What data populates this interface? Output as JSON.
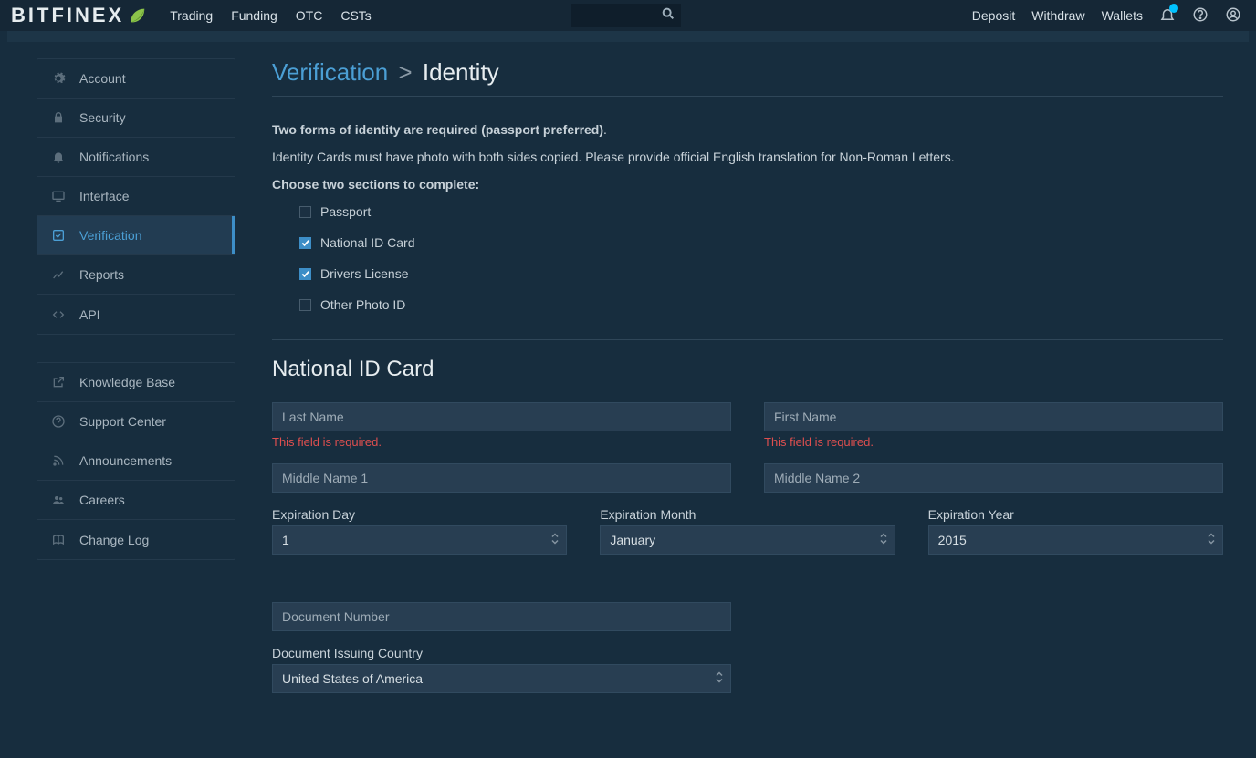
{
  "brand": {
    "name": "BITFINEX"
  },
  "topnav": {
    "items": [
      "Trading",
      "Funding",
      "OTC",
      "CSTs"
    ]
  },
  "rightnav": {
    "items": [
      "Deposit",
      "Withdraw",
      "Wallets"
    ]
  },
  "search": {
    "placeholder": ""
  },
  "sidebar": {
    "group1": [
      {
        "label": "Account",
        "icon": "gear-icon"
      },
      {
        "label": "Security",
        "icon": "lock-icon"
      },
      {
        "label": "Notifications",
        "icon": "bell-icon"
      },
      {
        "label": "Interface",
        "icon": "monitor-icon"
      },
      {
        "label": "Verification",
        "icon": "check-square-icon",
        "active": true
      },
      {
        "label": "Reports",
        "icon": "chart-line-icon"
      },
      {
        "label": "API",
        "icon": "code-icon"
      }
    ],
    "group2": [
      {
        "label": "Knowledge Base",
        "icon": "external-link-icon"
      },
      {
        "label": "Support Center",
        "icon": "help-icon"
      },
      {
        "label": "Announcements",
        "icon": "rss-icon"
      },
      {
        "label": "Careers",
        "icon": "people-icon"
      },
      {
        "label": "Change Log",
        "icon": "book-icon"
      }
    ]
  },
  "page": {
    "crumb_root": "Verification",
    "crumb_sep": ">",
    "crumb_leaf": "Identity",
    "intro1_bold": "Two forms of identity are required (passport preferred)",
    "intro1_tail": ".",
    "intro2": "Identity Cards must have photo with both sides copied. Please provide official English translation for Non-Roman Letters.",
    "intro3": "Choose two sections to complete:",
    "id_types": [
      {
        "label": "Passport",
        "checked": false
      },
      {
        "label": "National ID Card",
        "checked": true
      },
      {
        "label": "Drivers License",
        "checked": true
      },
      {
        "label": "Other Photo ID",
        "checked": false
      }
    ],
    "section_title": "National ID Card",
    "form": {
      "last_name": {
        "placeholder": "Last Name",
        "error": "This field is required."
      },
      "first_name": {
        "placeholder": "First Name",
        "error": "This field is required."
      },
      "middle1": {
        "placeholder": "Middle Name 1"
      },
      "middle2": {
        "placeholder": "Middle Name 2"
      },
      "exp_day": {
        "label": "Expiration Day",
        "value": "1"
      },
      "exp_month": {
        "label": "Expiration Month",
        "value": "January"
      },
      "exp_year": {
        "label": "Expiration Year",
        "value": "2015"
      },
      "doc_num": {
        "placeholder": "Document Number"
      },
      "issuing": {
        "label": "Document Issuing Country",
        "value": "United States of America"
      }
    }
  }
}
